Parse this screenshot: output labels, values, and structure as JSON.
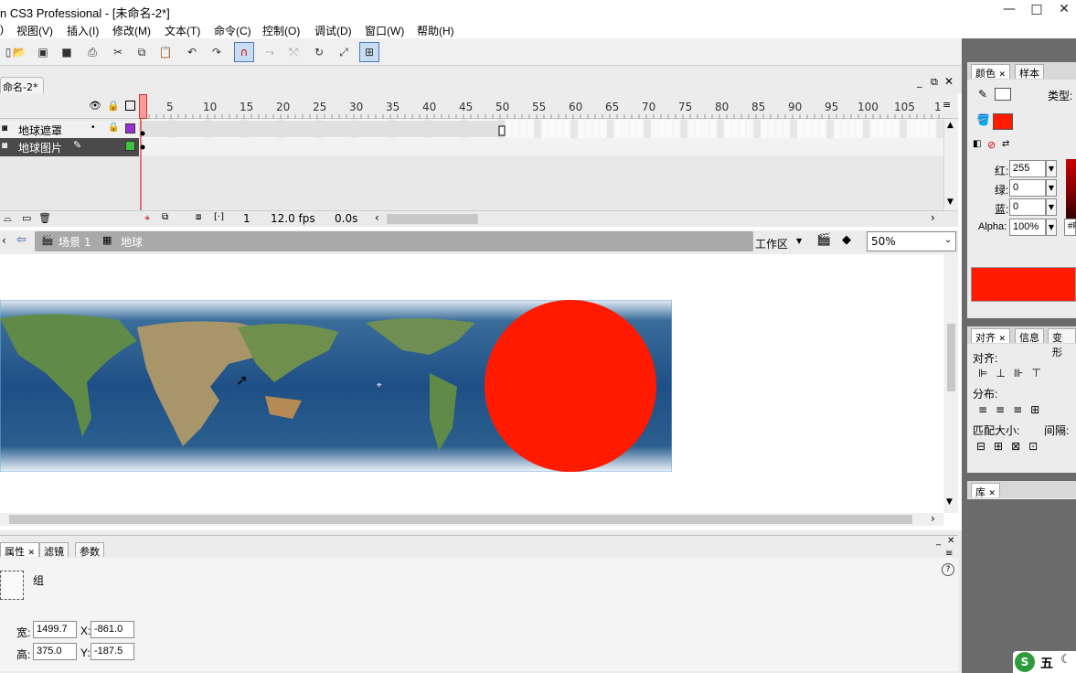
{
  "window": {
    "title": "n CS3 Professional - [未命名-2*]",
    "min": "—",
    "max": "□",
    "close": "✕"
  },
  "menu": [
    "视图(V)",
    "插入(I)",
    "修改(M)",
    "文本(T)",
    "命令(C)",
    "控制(O)",
    "调试(D)",
    "窗口(W)",
    "帮助(H)"
  ],
  "menu_left_stub": ")",
  "document": {
    "tab": "命名-2*"
  },
  "timeline": {
    "frame_numbers": [
      "5",
      "10",
      "15",
      "20",
      "25",
      "30",
      "35",
      "40",
      "45",
      "50",
      "55",
      "60",
      "65",
      "70",
      "75",
      "80",
      "85",
      "90",
      "95",
      "100",
      "105",
      "1"
    ],
    "layers": [
      {
        "name": "地球遮罩",
        "color": "#9b30d9"
      },
      {
        "name": "地球图片",
        "color": "#3cc43c"
      }
    ],
    "status": {
      "frame": "1",
      "fps": "12.0 fps",
      "time": "0.0s"
    }
  },
  "scene": {
    "scene_label": "场景 1",
    "symbol_label": "地球",
    "workspace": "工作区",
    "zoom": "50%"
  },
  "properties": {
    "tabs": [
      "属性",
      "滤镜",
      "参数"
    ],
    "type_label": "组",
    "width_label": "宽:",
    "width": "1499.7",
    "height_label": "高:",
    "height": "375.0",
    "x_label": "X:",
    "x": "-861.0",
    "y_label": "Y:",
    "y": "-187.5",
    "help": "?"
  },
  "color_panel": {
    "tabs": [
      "颜色",
      "样本"
    ],
    "type_label": "类型:",
    "r_label": "红:",
    "r": "255",
    "g_label": "绿:",
    "g": "0",
    "b_label": "蓝:",
    "b": "0",
    "alpha_label": "Alpha:",
    "alpha": "100%",
    "hex_stub": "#F",
    "fill_color": "#ff1a00"
  },
  "align_panel": {
    "tabs": [
      "对齐",
      "信息",
      "变形"
    ],
    "align_label": "对齐:",
    "distribute_label": "分布:",
    "match_label": "匹配大小:",
    "spacing_label": "间隔:"
  },
  "library_panel": {
    "tab": "库"
  },
  "watermark": "五"
}
